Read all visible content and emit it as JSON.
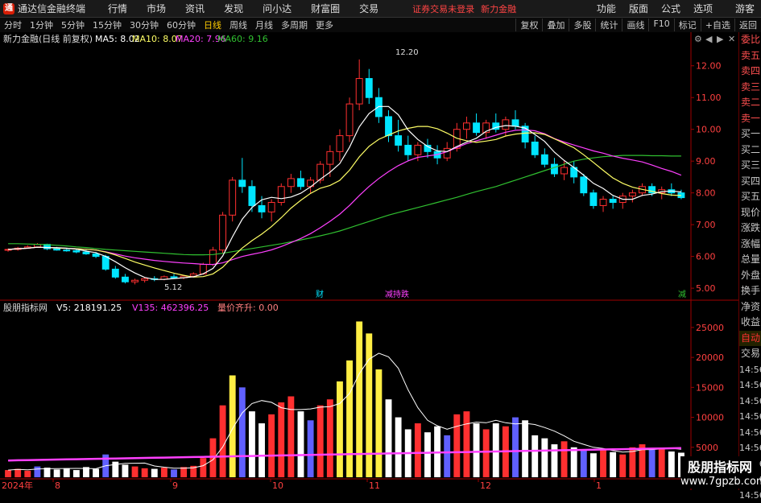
{
  "titlebar": {
    "app": "通达信金融终端",
    "menus": [
      "行情",
      "市场",
      "资讯",
      "发现",
      "问小达",
      "财富圈",
      "交易"
    ],
    "status": "证券交易未登录",
    "stock": "新力金融",
    "right": [
      "功能",
      "版面",
      "公式",
      "选项"
    ],
    "guest": "游客"
  },
  "periods": {
    "items": [
      "分时",
      "1分钟",
      "5分钟",
      "15分钟",
      "30分钟",
      "60分钟",
      "日线",
      "周线",
      "月线",
      "多周期",
      "更多"
    ],
    "active": "日线"
  },
  "tools": [
    "复权",
    "叠加",
    "多股",
    "统计",
    "画线",
    "F10",
    "标记",
    "+自选",
    "返回"
  ],
  "legend": {
    "name": "新力金融(日线 前复权)",
    "ma5": "MA5: 8.02",
    "ma10": "MA10: 8.07",
    "ma20": "MA20: 7.96",
    "ma60": "MA60: 9.16"
  },
  "vol_legend": {
    "name": "股朋指标网",
    "v5": "V5: 218191.25",
    "v135": "V135: 462396.25",
    "vp": "量价齐升: 0.00"
  },
  "price_axis": [
    "12.00",
    "11.00",
    "10.00",
    "9.00",
    "8.00",
    "7.00",
    "6.00",
    "5.00"
  ],
  "vol_axis": [
    "25000",
    "20000",
    "15000",
    "10000",
    "5000"
  ],
  "vol_axis_right": [
    "14:56",
    "14:56",
    "14:56",
    "14:56",
    "14:56",
    "14:56",
    "14:56",
    "14:56",
    "14:56"
  ],
  "x_axis": [
    "2024年",
    "8",
    "9",
    "10",
    "11",
    "12",
    "1"
  ],
  "annotations": {
    "high": "12.20",
    "low": "5.12",
    "m1": "财",
    "m2": "减持跌",
    "m3": "减"
  },
  "side_panel": [
    "委比",
    "卖五",
    "卖四",
    "卖三",
    "卖二",
    "卖一",
    "买一",
    "买二",
    "买三",
    "买四",
    "买五",
    "现价",
    "涨跌",
    "涨幅",
    "总量",
    "外盘",
    "换手",
    "净资",
    "收益",
    "自动",
    "交易"
  ],
  "watermark": {
    "line1": "股朋指标网",
    "line2": "www.7gpzb.com"
  },
  "colors": {
    "up": "#ff3030",
    "down": "#00e5ff",
    "ma5": "#ffffff",
    "ma10": "#ffff66",
    "ma20": "#ff40ff",
    "ma60": "#30c030",
    "axis": "#a00000"
  },
  "chart_data": {
    "type": "candlestick",
    "candles": [
      [
        6.2,
        6.25,
        6.15,
        6.22
      ],
      [
        6.22,
        6.3,
        6.18,
        6.26
      ],
      [
        6.26,
        6.35,
        6.24,
        6.3
      ],
      [
        6.3,
        6.42,
        6.28,
        6.38
      ],
      [
        6.38,
        6.4,
        6.2,
        6.24
      ],
      [
        6.24,
        6.3,
        6.18,
        6.2
      ],
      [
        6.2,
        6.26,
        6.15,
        6.18
      ],
      [
        6.18,
        6.22,
        6.1,
        6.14
      ],
      [
        6.14,
        6.2,
        6.05,
        6.08
      ],
      [
        6.08,
        6.14,
        5.95,
        6.0
      ],
      [
        6.0,
        6.05,
        5.55,
        5.6
      ],
      [
        5.6,
        5.7,
        5.3,
        5.35
      ],
      [
        5.35,
        5.45,
        5.15,
        5.2
      ],
      [
        5.2,
        5.3,
        5.12,
        5.25
      ],
      [
        5.25,
        5.35,
        5.18,
        5.3
      ],
      [
        5.3,
        5.38,
        5.22,
        5.28
      ],
      [
        5.28,
        5.4,
        5.25,
        5.36
      ],
      [
        5.36,
        5.45,
        5.3,
        5.33
      ],
      [
        5.33,
        5.4,
        5.28,
        5.38
      ],
      [
        5.38,
        5.5,
        5.35,
        5.45
      ],
      [
        5.45,
        5.8,
        5.42,
        5.75
      ],
      [
        5.75,
        6.3,
        5.7,
        6.2
      ],
      [
        6.2,
        7.4,
        6.1,
        7.3
      ],
      [
        7.3,
        8.5,
        7.1,
        8.4
      ],
      [
        8.4,
        9.1,
        8.0,
        8.2
      ],
      [
        8.2,
        8.4,
        7.4,
        7.6
      ],
      [
        7.6,
        7.9,
        7.2,
        7.4
      ],
      [
        7.4,
        7.8,
        7.1,
        7.7
      ],
      [
        7.7,
        8.3,
        7.6,
        8.2
      ],
      [
        8.2,
        8.6,
        8.0,
        8.45
      ],
      [
        8.45,
        8.7,
        8.1,
        8.2
      ],
      [
        8.2,
        8.5,
        8.0,
        8.4
      ],
      [
        8.4,
        9.0,
        8.3,
        8.9
      ],
      [
        8.9,
        9.5,
        8.5,
        9.3
      ],
      [
        9.3,
        10.0,
        9.0,
        9.8
      ],
      [
        9.8,
        11.0,
        9.6,
        10.8
      ],
      [
        10.8,
        12.2,
        10.6,
        11.6
      ],
      [
        11.6,
        11.9,
        10.8,
        11.0
      ],
      [
        11.0,
        11.3,
        10.2,
        10.4
      ],
      [
        10.4,
        10.6,
        9.6,
        9.8
      ],
      [
        9.8,
        10.3,
        9.3,
        9.5
      ],
      [
        9.5,
        9.8,
        9.0,
        9.2
      ],
      [
        9.2,
        9.6,
        9.0,
        9.5
      ],
      [
        9.5,
        9.7,
        9.1,
        9.3
      ],
      [
        9.3,
        9.5,
        8.9,
        9.1
      ],
      [
        9.1,
        9.6,
        9.0,
        9.4
      ],
      [
        9.4,
        10.2,
        9.3,
        10.0
      ],
      [
        10.0,
        10.4,
        9.7,
        10.2
      ],
      [
        10.2,
        10.5,
        9.8,
        9.9
      ],
      [
        9.9,
        10.3,
        9.7,
        10.2
      ],
      [
        10.2,
        10.5,
        9.9,
        10.0
      ],
      [
        10.0,
        10.4,
        9.8,
        10.3
      ],
      [
        10.3,
        10.6,
        10.0,
        10.1
      ],
      [
        10.1,
        10.2,
        9.4,
        9.6
      ],
      [
        9.6,
        9.8,
        9.1,
        9.2
      ],
      [
        9.2,
        9.4,
        8.8,
        8.9
      ],
      [
        8.9,
        9.1,
        8.5,
        8.6
      ],
      [
        8.6,
        9.0,
        8.4,
        8.8
      ],
      [
        8.8,
        9.0,
        8.3,
        8.5
      ],
      [
        8.5,
        8.6,
        7.9,
        8.0
      ],
      [
        8.0,
        8.1,
        7.5,
        7.6
      ],
      [
        7.6,
        7.9,
        7.4,
        7.8
      ],
      [
        7.8,
        7.9,
        7.5,
        7.7
      ],
      [
        7.7,
        8.0,
        7.5,
        7.9
      ],
      [
        7.9,
        8.1,
        7.7,
        8.0
      ],
      [
        8.0,
        8.3,
        7.9,
        8.2
      ],
      [
        8.2,
        8.3,
        7.9,
        8.0
      ],
      [
        8.0,
        8.2,
        7.8,
        8.1
      ],
      [
        8.1,
        8.3,
        7.9,
        8.0
      ],
      [
        8.0,
        8.1,
        7.8,
        7.85
      ]
    ],
    "ma60": [
      6.4,
      6.4,
      6.39,
      6.38,
      6.37,
      6.35,
      6.33,
      6.3,
      6.28,
      6.25,
      6.22,
      6.2,
      6.18,
      6.16,
      6.14,
      6.12,
      6.1,
      6.08,
      6.06,
      6.05,
      6.05,
      6.06,
      6.1,
      6.15,
      6.2,
      6.25,
      6.3,
      6.35,
      6.4,
      6.46,
      6.52,
      6.58,
      6.65,
      6.72,
      6.8,
      6.9,
      7.0,
      7.1,
      7.2,
      7.3,
      7.38,
      7.46,
      7.54,
      7.62,
      7.7,
      7.78,
      7.86,
      7.95,
      8.04,
      8.12,
      8.2,
      8.3,
      8.4,
      8.5,
      8.6,
      8.7,
      8.8,
      8.9,
      9.0,
      9.06,
      9.1,
      9.14,
      9.16,
      9.18,
      9.18,
      9.18,
      9.17,
      9.17,
      9.16,
      9.16
    ],
    "volumes": [
      1200,
      1400,
      1100,
      1800,
      1600,
      1300,
      1500,
      1200,
      1700,
      1400,
      3800,
      2600,
      2100,
      1800,
      1500,
      1400,
      1600,
      1300,
      1700,
      1900,
      3200,
      6500,
      12000,
      17000,
      15000,
      11000,
      9000,
      10500,
      12500,
      13500,
      11000,
      9500,
      12000,
      13000,
      16000,
      19500,
      26000,
      24000,
      18000,
      13000,
      10000,
      8000,
      9000,
      7500,
      8500,
      7000,
      10500,
      11000,
      9000,
      8000,
      9000,
      8500,
      10000,
      9500,
      7000,
      6500,
      5500,
      6000,
      5000,
      4500,
      4000,
      4500,
      4200,
      3800,
      5000,
      5500,
      4600,
      4800,
      4300,
      4100
    ],
    "ylim": [
      4.8,
      12.5
    ],
    "vol_ylim": [
      0,
      27000
    ]
  }
}
